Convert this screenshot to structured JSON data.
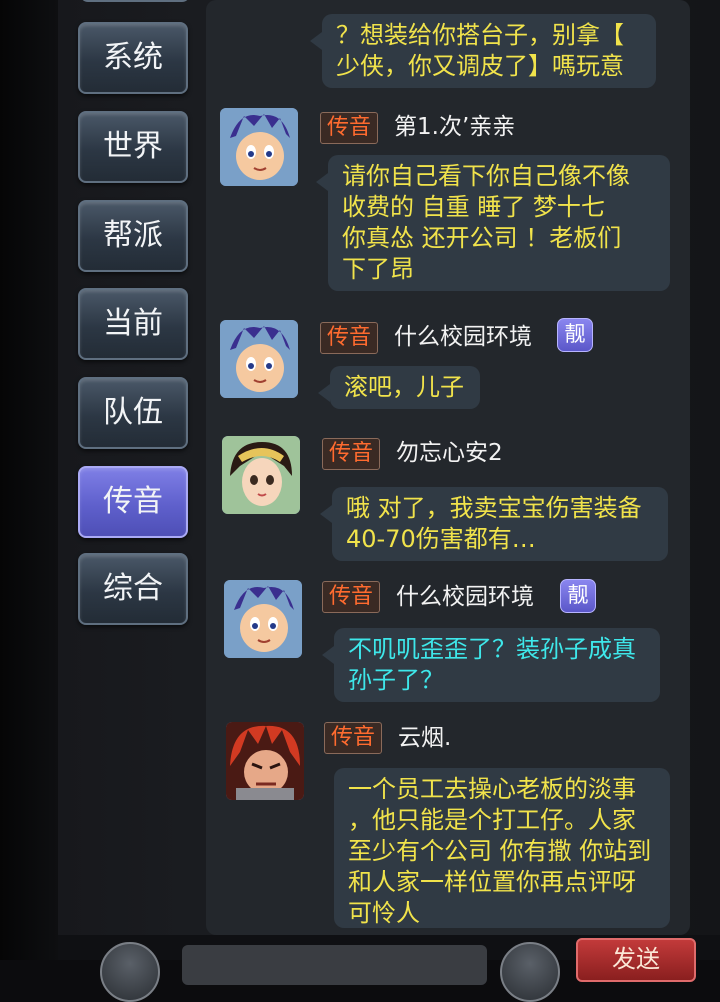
{
  "tabs": [
    {
      "label": "系统"
    },
    {
      "label": "世界"
    },
    {
      "label": "帮派"
    },
    {
      "label": "当前"
    },
    {
      "label": "队伍"
    },
    {
      "label": "传音",
      "active": true
    },
    {
      "label": "综合"
    }
  ],
  "messages": [
    {
      "text_lines": [
        "？想装给你搭台子，别拿【",
        "少侠，你又调皮了】嗎玩意"
      ],
      "color": "yellow"
    },
    {
      "channel": "传音",
      "sender": "第1.次’亲亲",
      "avatar": "blue-hair-boy-avatar",
      "text_lines": [
        "请你自己看下你自己像不像",
        "收费的  自重  睡了  梦十七",
        "你真怂 还开公司  ！老板们",
        "下了昂"
      ],
      "color": "yellow"
    },
    {
      "channel": "传音",
      "sender": "什么校园环境",
      "badge": "靓",
      "avatar": "blue-hair-boy-avatar",
      "text_lines": [
        "滚吧，儿子"
      ],
      "color": "yellow"
    },
    {
      "channel": "传音",
      "sender": "勿忘心安2",
      "avatar": "girl-headdress-avatar",
      "text_lines": [
        "哦 对了，我卖宝宝伤害装备",
        "40-70伤害都有…"
      ],
      "color": "yellow"
    },
    {
      "channel": "传音",
      "sender": "什么校园环境",
      "badge": "靓",
      "avatar": "blue-hair-boy-avatar",
      "text_lines": [
        "不叽叽歪歪了？装孙子成真",
        "孙子了？"
      ],
      "color": "cyan"
    },
    {
      "channel": "传音",
      "sender": "云烟.",
      "avatar": "red-hair-warrior-avatar",
      "text_lines": [
        "一个员工去操心老板的淡事",
        "，他只能是个打工仔。人家",
        "至少有个公司 你有撒 你站到",
        "和人家一样位置你再点评呀",
        "可怜人"
      ],
      "color": "yellow"
    }
  ],
  "bottom": {
    "send_label": "发送"
  },
  "colors": {
    "message_yellow": "#f1e34b",
    "message_cyan": "#3ee7ea",
    "channel_orange": "#ff6b2f",
    "active_tab": "#6464d4"
  }
}
